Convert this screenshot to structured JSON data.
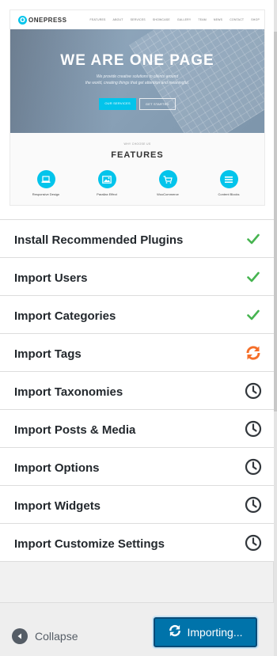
{
  "preview": {
    "logo_letter": "O",
    "logo_text": "ONEPRESS",
    "nav": [
      "FEATURES",
      "ABOUT",
      "SERVICES",
      "SHOWCASE",
      "GALLERY",
      "TEAM",
      "NEWS",
      "CONTACT",
      "SHOP"
    ],
    "hero_title": "WE ARE ONE PAGE",
    "hero_sub_line1": "We provide creative solutions to clients around",
    "hero_sub_line2": "the world, creating things that get attention and meaningful.",
    "btn_primary": "OUR SERVICES",
    "btn_secondary": "GET STARTED",
    "features_kicker": "WHY CHOOSE US",
    "features_title": "FEATURES",
    "features": [
      {
        "label": "Responsive Design",
        "icon": "laptop-icon"
      },
      {
        "label": "Parallax Effect",
        "icon": "image-icon"
      },
      {
        "label": "WooCommerce",
        "icon": "cart-icon"
      },
      {
        "label": "Content Blocks",
        "icon": "list-icon"
      }
    ],
    "accent_color": "#03c4eb"
  },
  "steps": [
    {
      "label": "Install Recommended Plugins",
      "status": "done"
    },
    {
      "label": "Import Users",
      "status": "done"
    },
    {
      "label": "Import Categories",
      "status": "done"
    },
    {
      "label": "Import Tags",
      "status": "running"
    },
    {
      "label": "Import Taxonomies",
      "status": "pending"
    },
    {
      "label": "Import Posts & Media",
      "status": "pending"
    },
    {
      "label": "Import Options",
      "status": "pending"
    },
    {
      "label": "Import Widgets",
      "status": "pending"
    },
    {
      "label": "Import Customize Settings",
      "status": "pending"
    }
  ],
  "status_colors": {
    "done": "#46b450",
    "running": "#f56e28",
    "pending": "#32373c"
  },
  "status_icons": {
    "done": "check-icon",
    "running": "sync-icon",
    "pending": "clock-icon"
  },
  "footer": {
    "collapse_label": "Collapse",
    "importing_label": "Importing...",
    "button_color": "#0073aa"
  }
}
